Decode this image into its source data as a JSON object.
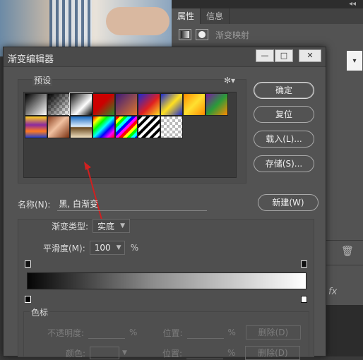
{
  "panel": {
    "tabs": [
      "属性",
      "信息"
    ],
    "title": "渐变映射",
    "collapse": "◂◂"
  },
  "dialog": {
    "title": "渐变编辑器",
    "window_buttons": {
      "minimize": "—",
      "maximize": "□",
      "close": "✕"
    },
    "presets_label": "预设",
    "gear": "✻▾",
    "buttons": {
      "ok": "确定",
      "reset": "复位",
      "load": "载入(L)...",
      "save": "存储(S)...",
      "new": "新建(W)"
    },
    "name_label": "名称(N):",
    "name_value": "黑, 白渐变",
    "gradient_type_label": "渐变类型:",
    "gradient_type_value": "实底",
    "smoothness_label": "平滑度(M):",
    "smoothness_value": "100",
    "smoothness_unit": "%",
    "stops_label": "色标",
    "opacity_label": "不透明度:",
    "opacity_unit": "%",
    "position_label": "位置:",
    "position_unit": "%",
    "delete_label": "删除(D)",
    "color_label": "颜色:"
  },
  "swatches": [
    {
      "name": "black-white",
      "bg": "linear-gradient(135deg,#000 0%,#fff 100%)"
    },
    {
      "name": "black-transparent",
      "bg": "linear-gradient(135deg,#000 0%,rgba(0,0,0,0) 100%),repeating-conic-gradient(#bbb 0 25%,#fff 0 50%) 0 0/8px 8px"
    },
    {
      "name": "white-black",
      "bg": "linear-gradient(135deg,#111 0%,#fff 60%,#000 100%)"
    },
    {
      "name": "red-green",
      "bg": "linear-gradient(135deg,#c00 0%,#c00 45%,#2a8a2a 100%)"
    },
    {
      "name": "violet-orange",
      "bg": "linear-gradient(135deg,#3b1a7a 0%,#e0782a 100%)"
    },
    {
      "name": "blue-red-yellow",
      "bg": "linear-gradient(135deg,#1a2ad0 0%,#e02020 55%,#ffe020 100%)"
    },
    {
      "name": "blue-yellow-blue",
      "bg": "linear-gradient(135deg,#1a2ad0 0%,#ffe020 50%,#1a2ad0 100%)"
    },
    {
      "name": "orange-yellow-orange",
      "bg": "linear-gradient(135deg,#ff8a00 0%,#ffe030 50%,#ff8a00 100%)"
    },
    {
      "name": "violet-green-orange",
      "bg": "linear-gradient(135deg,#7a1aa0 0%,#2a9a3a 50%,#ff8a00 100%)"
    },
    {
      "name": "yellow-violet-orange-blue",
      "bg": "linear-gradient(180deg,#ffd020 0%,#8a2aa0 40%,#ff7a20 70%,#2040d0 100%)"
    },
    {
      "name": "copper",
      "bg": "linear-gradient(135deg,#8a4020 0%,#f0c0a0 45%,#7a3010 100%)"
    },
    {
      "name": "chrome",
      "bg": "linear-gradient(180deg,#1a6ac0 0%,#e0f0ff 48%,#6a4a20 52%,#f0e0c0 100%)"
    },
    {
      "name": "spectrum",
      "bg": "linear-gradient(135deg,#f00,#ff0,#0f0,#0ff,#00f,#f0f,#f00)"
    },
    {
      "name": "transparent-rainbow",
      "bg": "repeating-linear-gradient(135deg,#f00 0 4px,#ff0 4px 8px,#0f0 8px 12px,#0ff 12px 16px,#00f 16px 20px,#f0f 20px 24px)"
    },
    {
      "name": "transparent-stripes",
      "bg": "repeating-linear-gradient(135deg,#000 0 4px,#fff 4px 8px)"
    },
    {
      "name": "transparent",
      "bg": "repeating-conic-gradient(#bbb 0 25%,#fff 0 50%) 0 0/8px 8px"
    }
  ]
}
